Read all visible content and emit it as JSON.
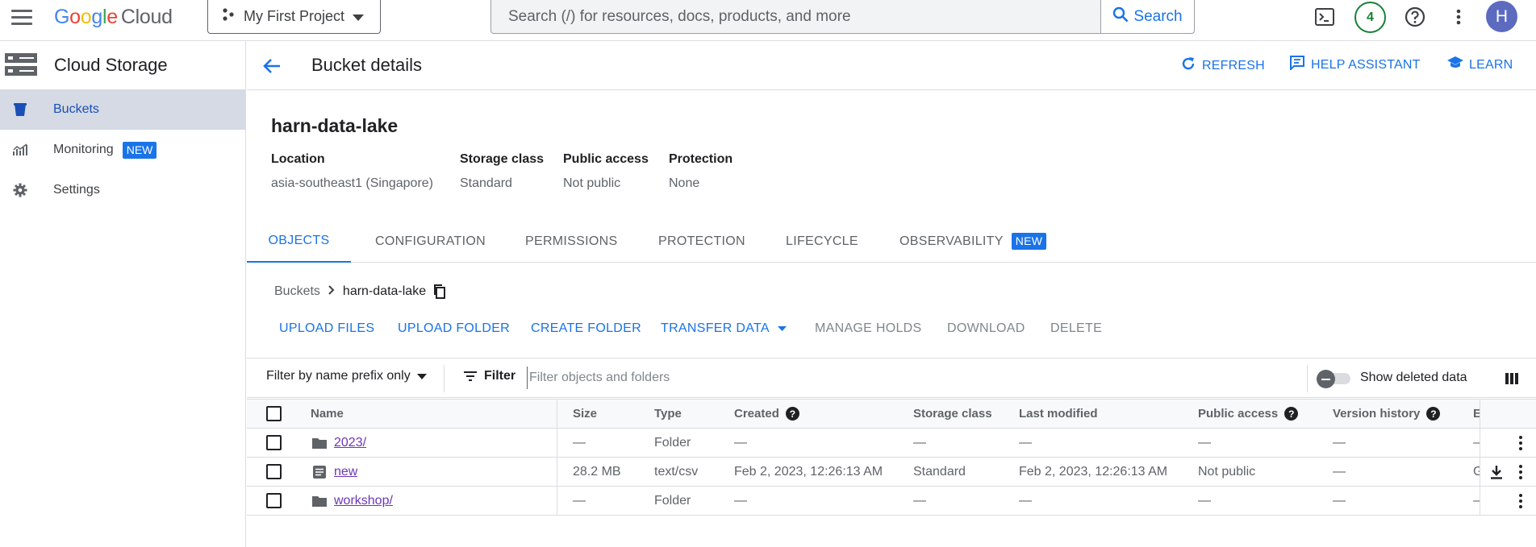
{
  "topbar": {
    "logo_letters": [
      "G",
      "o",
      "o",
      "g",
      "l",
      "e"
    ],
    "logo_product": "Cloud",
    "project": "My First Project",
    "search_placeholder": "Search (/) for resources, docs, products, and more",
    "search_button": "Search",
    "notifications_count": "4",
    "avatar_initial": "H"
  },
  "sidebar": {
    "title": "Cloud Storage",
    "items": [
      {
        "label": "Buckets",
        "icon": "bucket-icon",
        "active": true
      },
      {
        "label": "Monitoring",
        "icon": "monitoring-icon",
        "badge": "NEW"
      },
      {
        "label": "Settings",
        "icon": "gear-icon"
      }
    ]
  },
  "header": {
    "title": "Bucket details",
    "refresh": "REFRESH",
    "help_assistant": "HELP ASSISTANT",
    "learn": "LEARN"
  },
  "bucket": {
    "name": "harn-data-lake",
    "meta": [
      {
        "label": "Location",
        "value": "asia-southeast1 (Singapore)"
      },
      {
        "label": "Storage class",
        "value": "Standard"
      },
      {
        "label": "Public access",
        "value": "Not public"
      },
      {
        "label": "Protection",
        "value": "None"
      }
    ]
  },
  "tabs": [
    {
      "label": "OBJECTS",
      "active": true
    },
    {
      "label": "CONFIGURATION"
    },
    {
      "label": "PERMISSIONS"
    },
    {
      "label": "PROTECTION"
    },
    {
      "label": "LIFECYCLE"
    },
    {
      "label": "OBSERVABILITY",
      "badge": "NEW"
    }
  ],
  "breadcrumb": {
    "root": "Buckets",
    "current": "harn-data-lake"
  },
  "toolbar": {
    "upload_files": "UPLOAD FILES",
    "upload_folder": "UPLOAD FOLDER",
    "create_folder": "CREATE FOLDER",
    "transfer_data": "TRANSFER DATA",
    "manage_holds": "MANAGE HOLDS",
    "download": "DOWNLOAD",
    "delete": "DELETE"
  },
  "filterbar": {
    "prefix_mode": "Filter by name prefix only",
    "filter_label": "Filter",
    "filter_placeholder": "Filter objects and folders",
    "show_deleted": "Show deleted data",
    "show_deleted_on": false
  },
  "table": {
    "columns": {
      "name": "Name",
      "size": "Size",
      "type": "Type",
      "created": "Created",
      "storage_class": "Storage class",
      "last_modified": "Last modified",
      "public_access": "Public access",
      "version_history": "Version history",
      "truncated": "E"
    },
    "rows": [
      {
        "name": "2023/",
        "icon": "folder-icon",
        "size": "—",
        "type": "Folder",
        "created": "—",
        "storage_class": "—",
        "last_modified": "—",
        "public_access": "—",
        "version_history": "—",
        "truncated": "–",
        "downloadable": false
      },
      {
        "name": "new",
        "icon": "file-icon",
        "size": "28.2 MB",
        "type": "text/csv",
        "created": "Feb 2, 2023, 12:26:13 AM",
        "storage_class": "Standard",
        "last_modified": "Feb 2, 2023, 12:26:13 AM",
        "public_access": "Not public",
        "version_history": "—",
        "truncated": "G",
        "downloadable": true
      },
      {
        "name": "workshop/",
        "icon": "folder-icon",
        "size": "—",
        "type": "Folder",
        "created": "—",
        "storage_class": "—",
        "last_modified": "—",
        "public_access": "—",
        "version_history": "—",
        "truncated": "–",
        "downloadable": false
      }
    ]
  },
  "colors": {
    "accent": "#1a73e8",
    "link_visited": "#6e35b5",
    "active_nav_bg": "#d5dae4"
  }
}
